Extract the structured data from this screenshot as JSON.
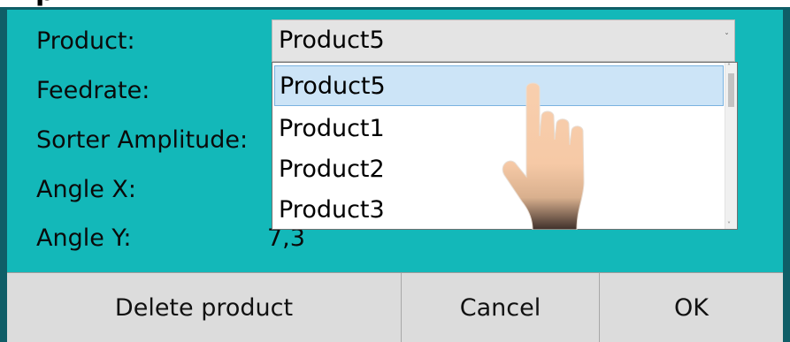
{
  "title_fragment": "p",
  "form": {
    "product_label": "Product:",
    "feedrate_label": "Feedrate:",
    "sorter_amplitude_label": "Sorter Amplitude:",
    "angle_x_label": "Angle X:",
    "angle_y_label": "Angle Y:",
    "angle_y_value": "7,3"
  },
  "product_select": {
    "selected": "Product5",
    "options": [
      "Product5",
      "Product1",
      "Product2",
      "Product3"
    ]
  },
  "buttons": {
    "delete": "Delete product",
    "cancel": "Cancel",
    "ok": "OK"
  },
  "icons": {
    "pointer": "hand-pointer-icon",
    "dropdown": "chevron-down-icon",
    "scroll_up": "scroll-up-arrow-icon",
    "scroll_down": "scroll-down-arrow-icon"
  },
  "colors": {
    "panel_background": "#13b8b9",
    "selection_highlight": "#cce4f7",
    "button_bar": "#d6d6d6"
  }
}
